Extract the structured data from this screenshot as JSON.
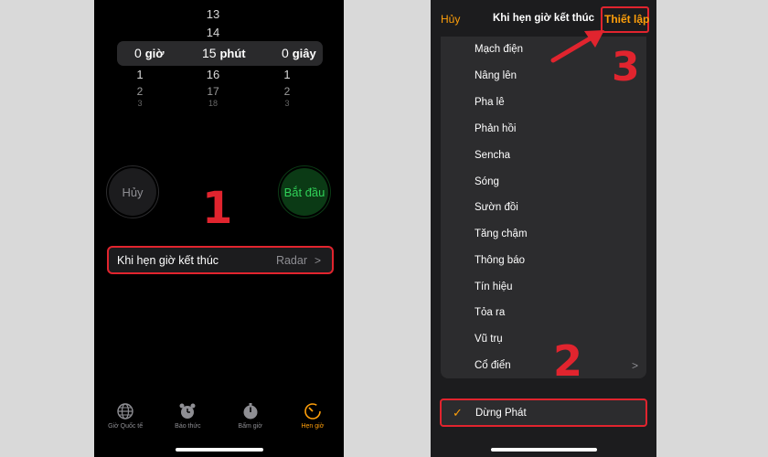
{
  "left": {
    "picker": {
      "hours_above": [
        "",
        "",
        ""
      ],
      "minutes_above": [
        "13",
        "14"
      ],
      "seconds_above": [
        "",
        ""
      ],
      "hours_selected": "0",
      "hours_unit": "giờ",
      "minutes_selected": "15",
      "minutes_unit": "phút",
      "seconds_selected": "0",
      "seconds_unit": "giây",
      "hours_below": [
        "1",
        "2",
        "3"
      ],
      "minutes_below": [
        "16",
        "17",
        "18"
      ],
      "seconds_below": [
        "1",
        "2",
        "3"
      ]
    },
    "cancel_label": "Hủy",
    "start_label": "Bắt đầu",
    "when_timer_ends": {
      "label": "Khi hẹn giờ kết thúc",
      "value": "Radar",
      "chevron": ">"
    },
    "callout_1": "1",
    "tabs": [
      {
        "label": "Giờ Quốc tế",
        "icon": "globe-icon",
        "active": false
      },
      {
        "label": "Báo thức",
        "icon": "alarm-clock-icon",
        "active": false
      },
      {
        "label": "Bấm giờ",
        "icon": "stopwatch-icon",
        "active": false
      },
      {
        "label": "Hẹn giờ",
        "icon": "timer-icon",
        "active": true
      }
    ]
  },
  "right": {
    "nav": {
      "cancel": "Hủy",
      "title": "Khi hẹn giờ kết thúc",
      "set": "Thiết lập"
    },
    "sounds": [
      "Mạch điện",
      "Nâng lên",
      "Pha lê",
      "Phản hồi",
      "Sencha",
      "Sóng",
      "Sườn đồi",
      "Tăng chậm",
      "Thông báo",
      "Tín hiệu",
      "Tỏa ra",
      "Vũ trụ",
      "Cổ điển"
    ],
    "classic_chevron": ">",
    "stop_playing": {
      "check": "✓",
      "label": "Dừng Phát"
    },
    "callout_2": "2",
    "callout_3": "3"
  },
  "colors": {
    "accent_orange": "#ff9f0a",
    "highlight_red": "#e1242e",
    "start_green": "#30d158"
  }
}
